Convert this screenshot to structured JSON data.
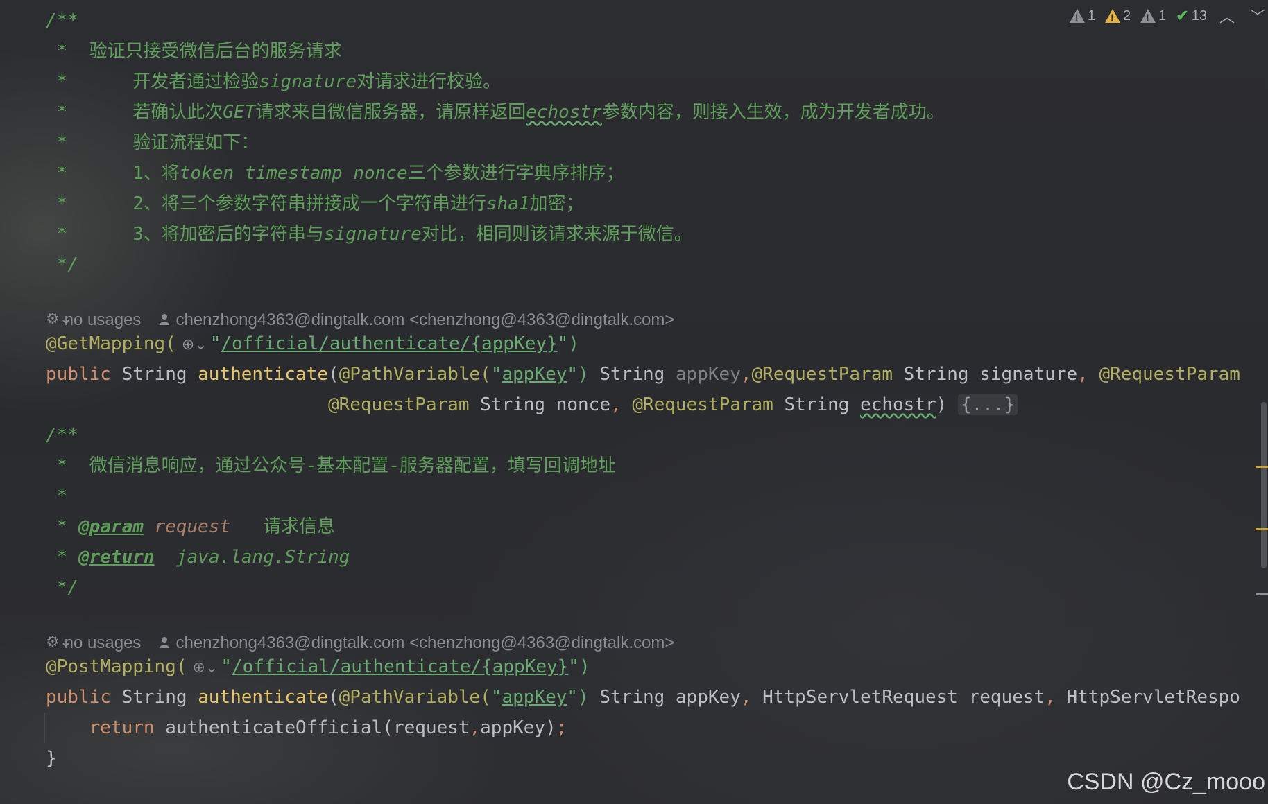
{
  "status": {
    "warn_gray_1": "1",
    "warn_yellow": "2",
    "warn_gray_2": "1",
    "typos": "13"
  },
  "doc1": {
    "open": "/**",
    "l1": " *  验证只接受微信后台的服务请求",
    "l2a": " *      开发者通过检验",
    "l2b": "signature",
    "l2c": "对请求进行校验。",
    "l3a": " *      若确认此次",
    "l3b": "GET",
    "l3c": "请求来自微信服务器，请原样返回",
    "l3d": "echostr",
    "l3e": "参数内容，则接入生效，成为开发者成功。",
    "l4": " *      验证流程如下：",
    "l5a": " *      ",
    "l5b": "1、将",
    "l5c": "token timestamp nonce",
    "l5d": "三个参数进行字典序排序；",
    "l6a": " *      ",
    "l6b": "2、将三个参数字符串拼接成一个字符串进行",
    "l6c": "sha1",
    "l6d": "加密；",
    "l7a": " *      ",
    "l7b": "3、将加密后的字符串与",
    "l7c": "signature",
    "l7d": "对比，相同则该请求来源于微信。",
    "close": " */"
  },
  "meta1": {
    "usages": "no usages",
    "author": "chenzhong4363@dingtalk.com <chenzhong@4363@dingtalk.com>"
  },
  "method1": {
    "annotation": "@GetMapping(",
    "path_q1": "\"",
    "path": "/official/authenticate/{appKey}",
    "path_q2": "\")",
    "kw_public": "public",
    "sp1": " String ",
    "name": "authenticate",
    "paren": "(",
    "pv": "@PathVariable(",
    "pv_q1": "\"",
    "pv_val": "appKey",
    "pv_q2": "\")",
    "rest1a": " String ",
    "rest1b": "appKey",
    "comma1": ",",
    "rp1": "@RequestParam",
    "rest1c": " String signature",
    "comma2": ", ",
    "rp2": "@RequestParam",
    "pad": "                          ",
    "rp3": "@RequestParam",
    "rest2a": " String nonce",
    "comma3": ", ",
    "rp4": "@RequestParam",
    "rest2b": " String ",
    "echostr": "echostr",
    "rest2c": ") ",
    "fold": "{...}"
  },
  "doc2": {
    "open": "/**",
    "l1": " *  微信消息响应，通过公众号-基本配置-服务器配置，填写回调地址",
    "l2": " *",
    "l3a": " * ",
    "l3tag": "@param",
    "l3name": " request",
    "l3desc": "   请求信息",
    "l4a": " * ",
    "l4tag": "@return",
    "l4desc": "  java.lang.String",
    "close": " */"
  },
  "meta2": {
    "usages": "no usages",
    "author": "chenzhong4363@dingtalk.com <chenzhong@4363@dingtalk.com>"
  },
  "method2": {
    "annotation": "@PostMapping(",
    "path_q1": "\"",
    "path": "/official/authenticate/{appKey}",
    "path_q2": "\")",
    "kw_public": "public",
    "sp1": " String ",
    "name": "authenticate",
    "paren": "(",
    "pv": "@PathVariable(",
    "pv_q1": "\"",
    "pv_val": "appKey",
    "pv_q2": "\")",
    "rest1": " String appKey",
    "comma1": ", ",
    "rest2": "HttpServletRequest request",
    "comma2": ", ",
    "rest3": "HttpServletRespo",
    "ret_indent": "    ",
    "kw_return": "return",
    "call": " authenticateOfficial(request",
    "comma3": ",",
    "call2": "appKey)",
    "semi": ";",
    "close_brace": "}"
  },
  "watermark": "CSDN @Cz_mooo"
}
